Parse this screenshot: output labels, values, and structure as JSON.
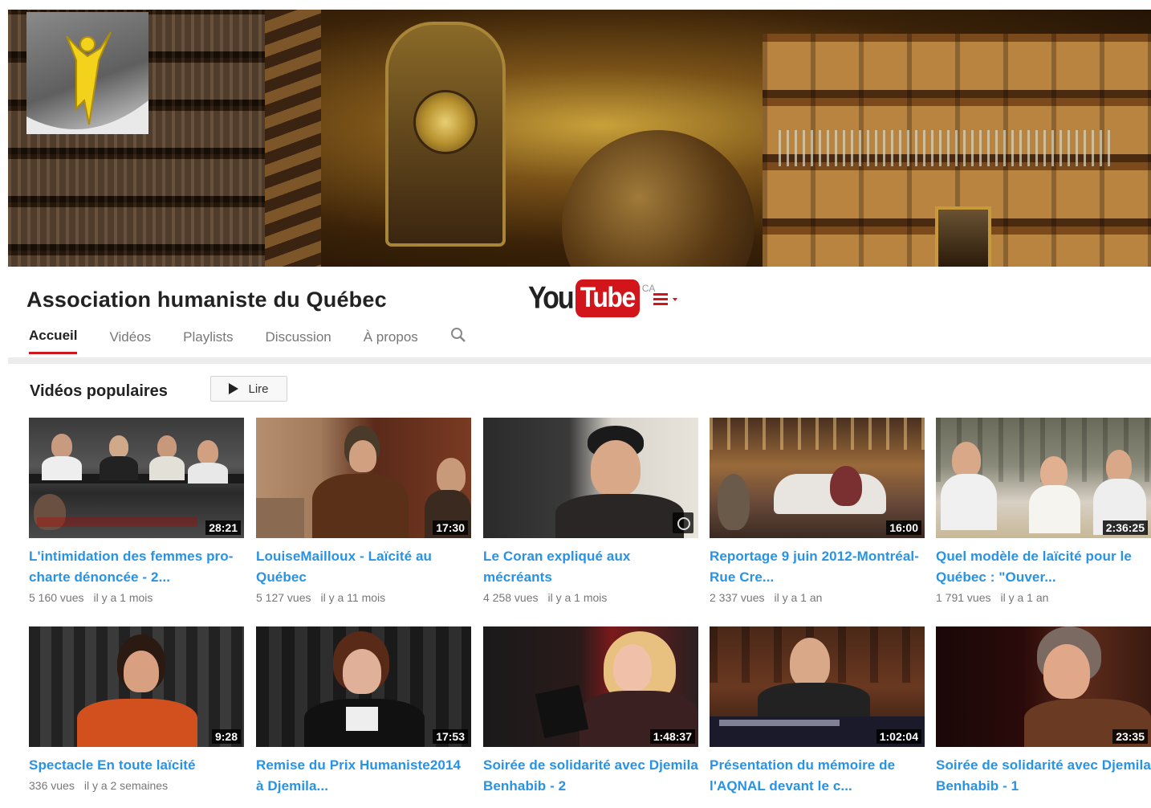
{
  "channel": {
    "name": "Association humaniste du Québec",
    "brand_color": "#cc181e"
  },
  "youtube_logo": {
    "you": "You",
    "tube": "Tube",
    "region": "CA"
  },
  "guide_icon": "menu-icon",
  "tabs": [
    {
      "label": "Accueil",
      "active": true
    },
    {
      "label": "Vidéos",
      "active": false
    },
    {
      "label": "Playlists",
      "active": false
    },
    {
      "label": "Discussion",
      "active": false
    },
    {
      "label": "À propos",
      "active": false
    }
  ],
  "section": {
    "title": "Vidéos populaires",
    "play_all_label": "Lire"
  },
  "videos": [
    {
      "title": "L'intimidation des femmes pro-charte dénoncée - 2...",
      "duration": "28:21",
      "views": "5 160 vues",
      "age": "il y a 1 mois"
    },
    {
      "title": "LouiseMailloux - Laïcité au Québec",
      "duration": "17:30",
      "views": "5 127 vues",
      "age": "il y a 11 mois"
    },
    {
      "title": "Le Coran expliqué aux mécréants",
      "duration": "",
      "views": "4 258 vues",
      "age": "il y a 1 mois"
    },
    {
      "title": "Reportage 9 juin 2012-Montréal-Rue Cre...",
      "duration": "16:00",
      "views": "2 337 vues",
      "age": "il y a 1 an"
    },
    {
      "title": "Quel modèle de laïcité pour le Québec : \"Ouver...",
      "duration": "2:36:25",
      "views": "1 791 vues",
      "age": "il y a 1 an"
    },
    {
      "title": "Spectacle En toute laïcité",
      "duration": "9:28",
      "views": "336 vues",
      "age": "il y a 2 semaines"
    },
    {
      "title": "Remise du Prix Humaniste2014 à Djemila...",
      "duration": "17:53",
      "views": "",
      "age": ""
    },
    {
      "title": "Soirée de solidarité avec Djemila Benhabib - 2",
      "duration": "1:48:37",
      "views": "",
      "age": ""
    },
    {
      "title": "Présentation du mémoire de l'AQNAL devant le c...",
      "duration": "1:02:04",
      "views": "",
      "age": ""
    },
    {
      "title": "Soirée de solidarité avec Djemila Benhabib - 1",
      "duration": "23:35",
      "views": "",
      "age": ""
    }
  ]
}
